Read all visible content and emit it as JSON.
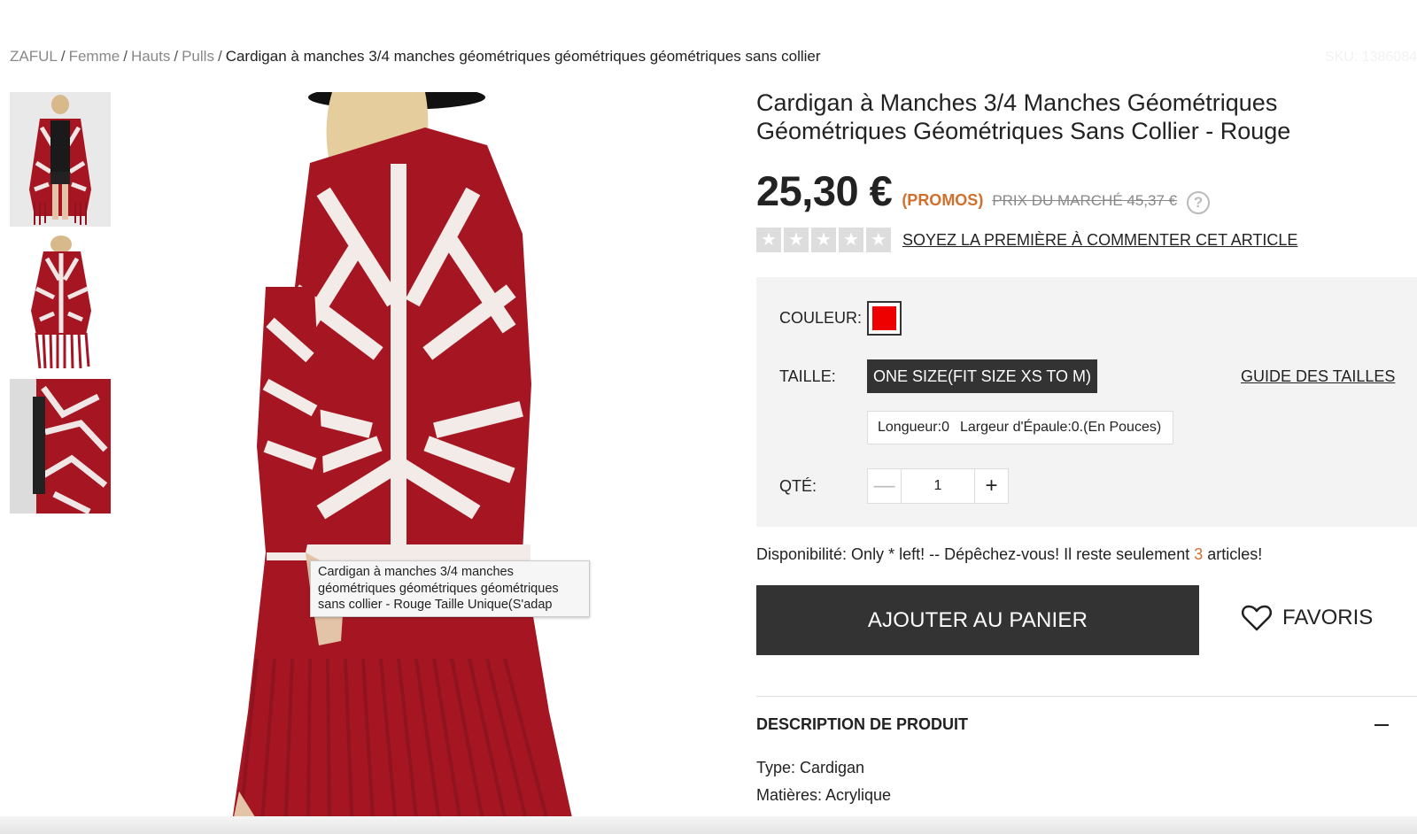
{
  "breadcrumb": {
    "items": [
      "ZAFUL",
      "Femme",
      "Hauts",
      "Pulls"
    ],
    "separator": "/",
    "current": "Cardigan à manches 3/4 manches géométriques géométriques géométriques sans collier"
  },
  "sku": "SKU: 1386084",
  "gallery": {
    "thumbnails": [
      "thumbnail-front-view",
      "thumbnail-back-view",
      "thumbnail-side-view"
    ],
    "main_image": "cardigan-back-view-photo"
  },
  "tooltip": "Cardigan à manches 3/4 manches géométriques géométriques géométriques sans collier - Rouge Taille Unique(S'adap",
  "product": {
    "title": "Cardigan à Manches 3/4 Manches Géométriques Géométriques Géométriques Sans Collier - Rouge",
    "price": "25,30 €",
    "promo_label": "(PROMOS)",
    "market_price": "PRIX DU MARCHÉ 45,37 €",
    "help_icon": "?",
    "rating_stars": 0,
    "rating_max": 5,
    "review_link": "SOYEZ LA PREMIÈRE À COMMENTER CET ARTICLE"
  },
  "options": {
    "color_label": "COULEUR:",
    "color_value": "#ee0000",
    "size_label": "TAILLE:",
    "size_value": "ONE SIZE(FIT SIZE XS TO M)",
    "size_guide": "GUIDE DES TAILLES",
    "measure_length": "Longueur:0",
    "measure_shoulder": "Largeur d'Épaule:0.(En Pouces)",
    "qty_label": "QTÉ:",
    "qty_value": "1",
    "qty_minus": "—",
    "qty_plus": "+"
  },
  "availability": {
    "prefix": "Disponibilité: Only * left! -- Dépêchez-vous! Il reste seulement",
    "count": "3",
    "suffix": "articles!"
  },
  "actions": {
    "add_to_cart": "AJOUTER AU PANIER",
    "favorites": "FAVORIS"
  },
  "description": {
    "heading": "DESCRIPTION DE PRODUIT",
    "lines": [
      "Type: Cardigan",
      "Matières: Acrylique"
    ]
  },
  "colors": {
    "accent": "#d36f2d",
    "dark_button": "#333333",
    "product_red": "#a51622"
  }
}
